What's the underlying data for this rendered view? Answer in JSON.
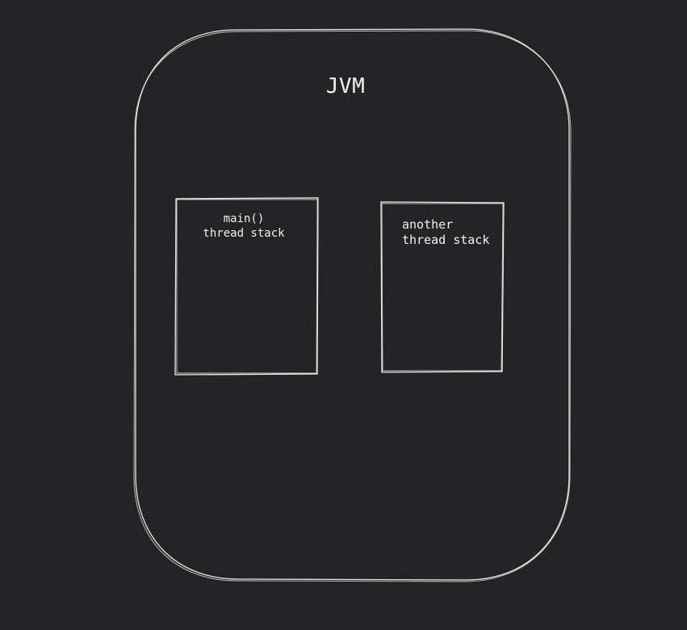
{
  "diagram": {
    "container": {
      "title": "JVM"
    },
    "boxes": [
      {
        "id": "main",
        "line1": "main()",
        "line2": "thread stack"
      },
      {
        "id": "another",
        "line1": "another",
        "line2": "thread stack"
      }
    ]
  },
  "colors": {
    "background": "#242426",
    "stroke": "#e6e6e6",
    "text": "#f2f2f2"
  }
}
